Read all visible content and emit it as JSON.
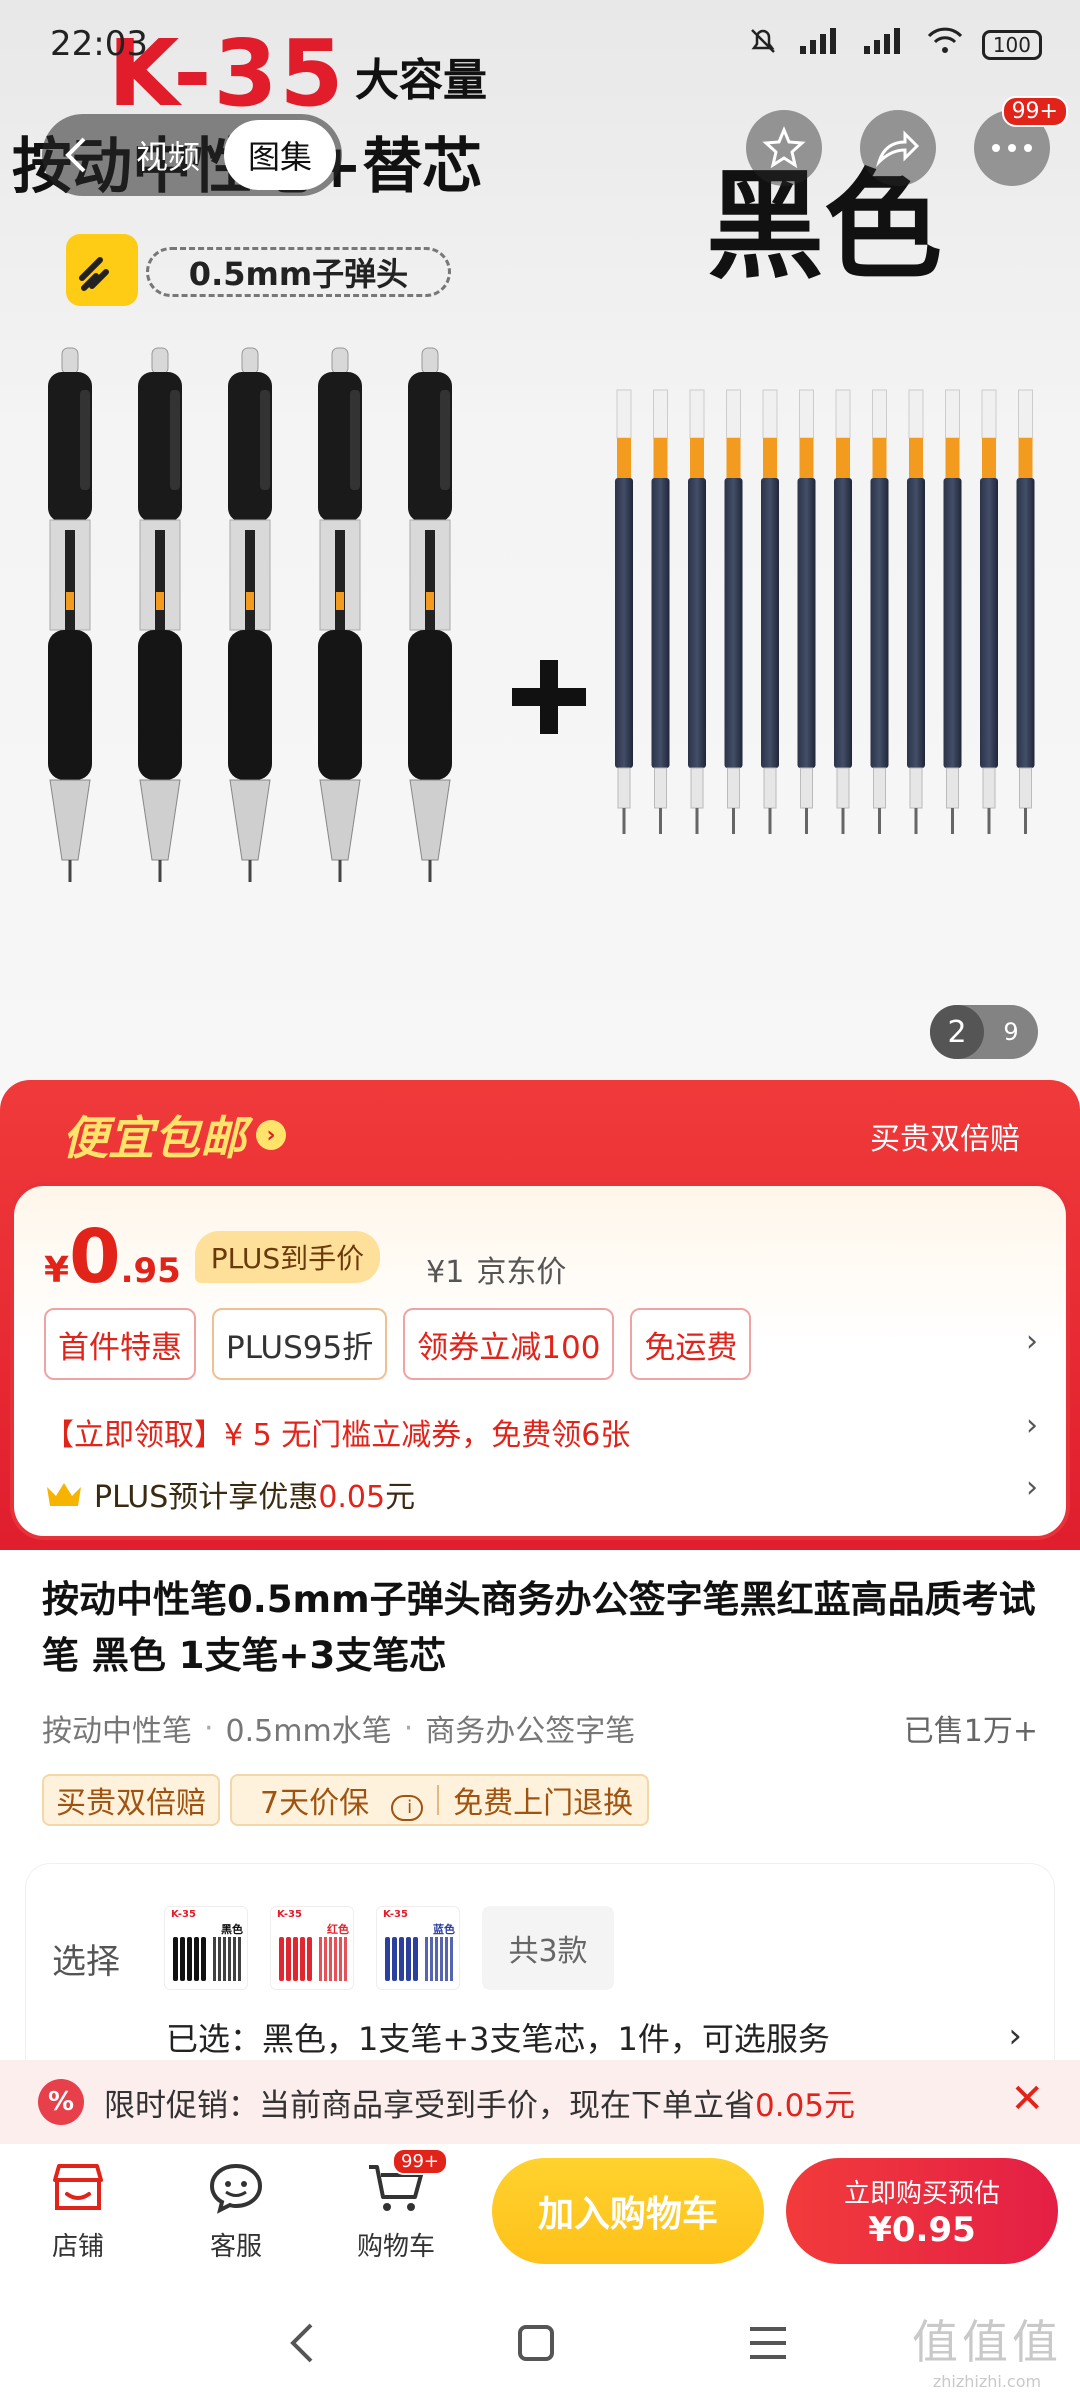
{
  "status_bar": {
    "time": "22:03",
    "battery": "100"
  },
  "banner": {
    "brand": "K-35",
    "capacity": "大容量",
    "line2": "按动中性笔+替芯",
    "color": "黑色",
    "spec": "0.5mm子弹头"
  },
  "media_tabs": {
    "video": "视频",
    "gallery": "图集"
  },
  "more_badge": "99+",
  "image_counter": {
    "current": "2",
    "total": "9"
  },
  "promo_banner": {
    "title": "便宜包邮",
    "right": "买贵双倍赔"
  },
  "price": {
    "currency": "¥",
    "integer": "0",
    "decimal": ".95",
    "plus_tag": "PLUS到手价",
    "jd_value": "¥1",
    "jd_label": "京东价"
  },
  "chips": [
    "首件特惠",
    "PLUS95折",
    "领券立减100",
    "免运费"
  ],
  "coupon_line": "【立即领取】¥ 5 无门槛立减券，免费领6张",
  "plus_line": {
    "text": "PLUS预计享优惠",
    "amount": "0.05",
    "unit": "元"
  },
  "product": {
    "title": "按动中性笔0.5mm子弹头商务办公签字笔黑红蓝高品质考试笔 黑色 1支笔+3支笔芯",
    "tags": [
      "按动中性笔",
      "0.5mm水笔",
      "商务办公签字笔"
    ],
    "sold": "已售1万+",
    "guarantees": [
      "买贵双倍赔",
      "7天价保",
      "免费上门退换"
    ]
  },
  "select": {
    "label": "选择",
    "thumb_brand": "K-35",
    "variants": [
      {
        "color": "黑色",
        "hex": "#111111"
      },
      {
        "color": "红色",
        "hex": "#e0262e"
      },
      {
        "color": "蓝色",
        "hex": "#2b3f9e"
      }
    ],
    "count": "共3款",
    "selected": "已选：黑色，1支笔+3支笔芯，1件，可选服务"
  },
  "promo_strip": {
    "icon": "%",
    "text": "限时促销：当前商品享受到手价，现在下单立省",
    "amount": "0.05元"
  },
  "bottom_bar": {
    "shop": "店铺",
    "service": "客服",
    "cart": "购物车",
    "cart_badge": "99+",
    "add_cart": "加入购物车",
    "buy_line1": "立即购买预估",
    "buy_line2": "¥0.95"
  },
  "watermark": {
    "logo": "值值值",
    "url": "zhizhizhi.com"
  },
  "colors": {
    "accent_red": "#e2231a",
    "cart_yellow": "#ffc11a",
    "plus_gold": "#ffe09a"
  }
}
